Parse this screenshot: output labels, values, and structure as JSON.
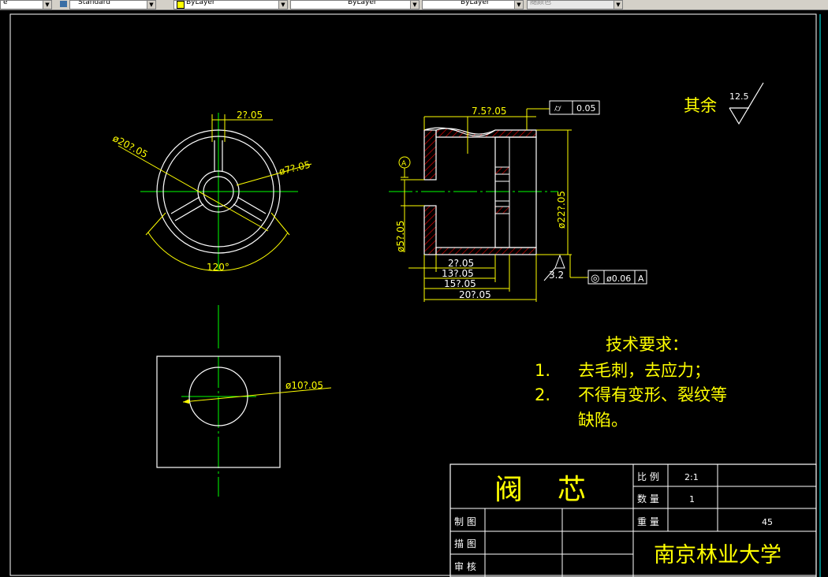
{
  "toolbar": {
    "text_style": "e",
    "dim_style": "Standard",
    "layer": "ByLayer",
    "linetype": "ByLayer",
    "lineweight": "ByLayer",
    "plot_style": "随颜色"
  },
  "drawing": {
    "front_view": {
      "dim_slot_width": "2?.05",
      "dim_outer_dia": "ø20?.05",
      "dim_hub_dia": "ø7?.05",
      "dim_angle": "120°"
    },
    "section_view": {
      "dim_top": "7.5?.05",
      "tolerance_symbol": "⌭",
      "tolerance_value": "0.05",
      "datum_label": "A",
      "dim_right_dia": "ø22?.05",
      "dim_bore_dia": "ø5?.05",
      "dim_h1": "2?.05",
      "dim_h2": "13?.05",
      "dim_h3": "15?.05",
      "dim_h4": "20?.05",
      "roughness": "3.2",
      "concentricity_symbol": "◎",
      "concentricity_value": "ø0.06",
      "concentricity_datum": "A"
    },
    "side_view": {
      "dim_dia": "ø10?.05"
    },
    "surface_note": {
      "label": "其余",
      "value": "12.5"
    },
    "requirements": {
      "title": "技术要求：",
      "item1_num": "1.",
      "item1_text": "去毛刺，去应力；",
      "item2_num": "2.",
      "item2_text": "不得有变形、裂纹等",
      "item2_cont": "缺陷。"
    },
    "title_block": {
      "part_name_1": "阀",
      "part_name_2": "芯",
      "scale_label": "比 例",
      "scale_value": "2:1",
      "qty_label": "数 量",
      "qty_value": "1",
      "weight_label": "重 量",
      "weight_value": "45",
      "drawn_label": "制 图",
      "traced_label": "描 图",
      "checked_label": "审 核",
      "school": "南京林业大学"
    }
  }
}
